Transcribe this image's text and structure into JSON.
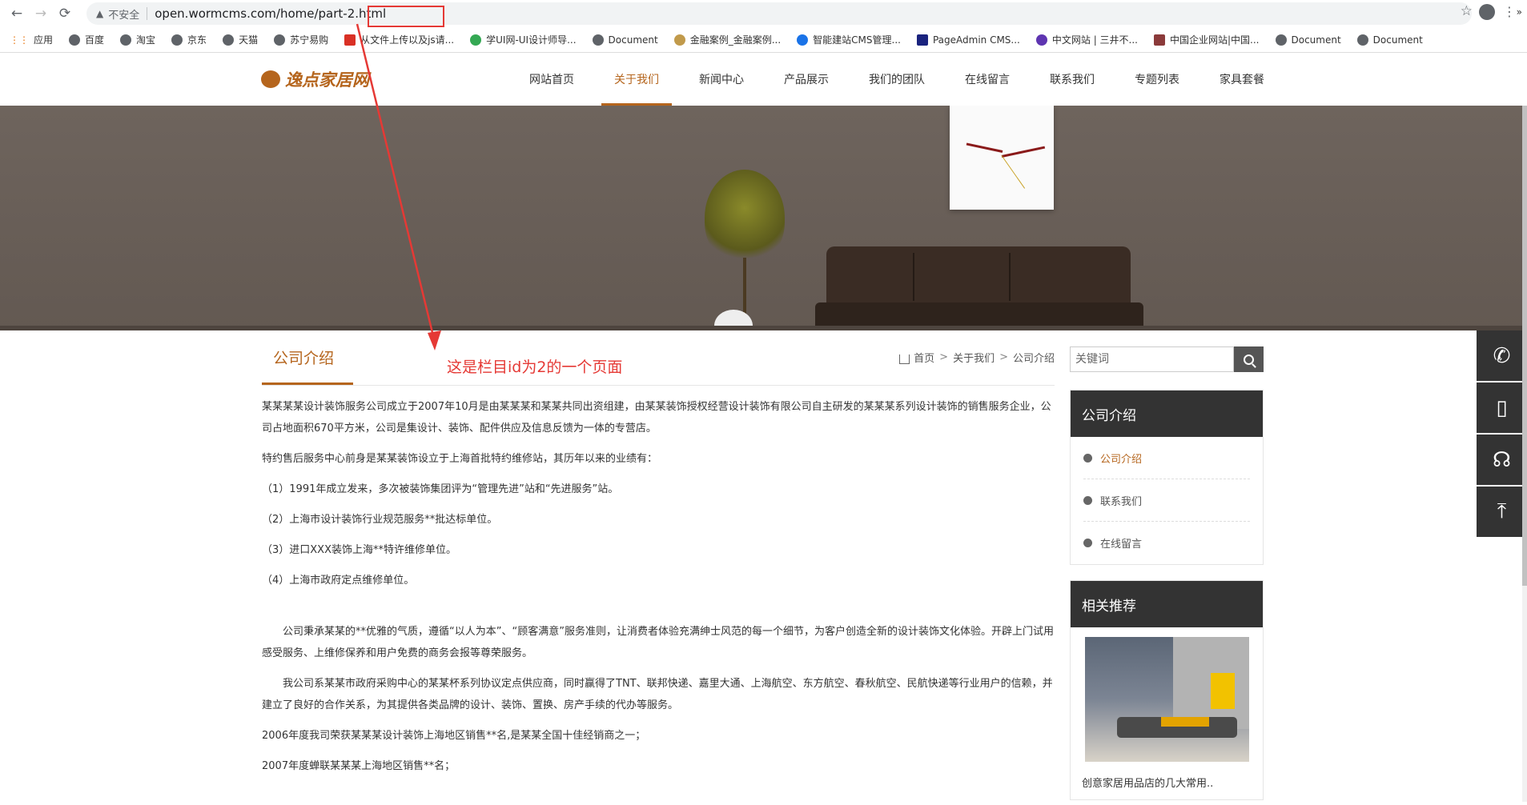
{
  "browser": {
    "security_label": "不安全",
    "url": "open.wormcms.com/home/part-2.html",
    "bookmarks": [
      {
        "label": "应用",
        "icon": "apps-grid-icon"
      },
      {
        "label": "百度",
        "icon": "globe-icon"
      },
      {
        "label": "淘宝",
        "icon": "globe-icon"
      },
      {
        "label": "京东",
        "icon": "globe-icon"
      },
      {
        "label": "天猫",
        "icon": "globe-icon"
      },
      {
        "label": "苏宁易购",
        "icon": "globe-icon"
      },
      {
        "label": "从文件上传以及js请...",
        "icon": "red-c-icon"
      },
      {
        "label": "学UI网-UI设计师导...",
        "icon": "green-icon"
      },
      {
        "label": "Document",
        "icon": "globe-icon"
      },
      {
        "label": "金融案例_金融案例...",
        "icon": "gold-icon"
      },
      {
        "label": "智能建站CMS管理...",
        "icon": "paw-icon"
      },
      {
        "label": "PageAdmin CMS...",
        "icon": "pa-icon"
      },
      {
        "label": "中文网站 | 三井不...",
        "icon": "man-icon"
      },
      {
        "label": "中国企业网站|中国...",
        "icon": "shield-icon"
      },
      {
        "label": "Document",
        "icon": "globe-icon"
      },
      {
        "label": "Document",
        "icon": "globe-icon"
      }
    ],
    "more": "»"
  },
  "site": {
    "logo_text": "逸点家居网",
    "nav": [
      {
        "label": "网站首页",
        "active": false
      },
      {
        "label": "关于我们",
        "active": true
      },
      {
        "label": "新闻中心",
        "active": false
      },
      {
        "label": "产品展示",
        "active": false
      },
      {
        "label": "我们的团队",
        "active": false
      },
      {
        "label": "在线留言",
        "active": false
      },
      {
        "label": "联系我们",
        "active": false
      },
      {
        "label": "专题列表",
        "active": false
      },
      {
        "label": "家具套餐",
        "active": false
      }
    ]
  },
  "page": {
    "title": "公司介绍",
    "breadcrumb": [
      "首页",
      "关于我们",
      "公司介绍"
    ],
    "breadcrumb_sep": ">",
    "paragraphs": [
      "某某某某设计装饰服务公司成立于2007年10月是由某某某和某某共同出资组建，由某某装饰授权经营设计装饰有限公司自主研发的某某某系列设计装饰的销售服务企业，公司占地面积670平方米，公司是集设计、装饰、配件供应及信息反馈为一体的专营店。",
      "特约售后服务中心前身是某某装饰设立于上海首批特约维修站，其历年以来的业绩有：",
      "（1）1991年成立发来，多次被装饰集团评为“管理先进”站和“先进服务”站。",
      "（2）上海市设计装饰行业规范服务**批达标单位。",
      "（3）进口XXX装饰上海**特许维修单位。",
      "（4）上海市政府定点维修单位。",
      "公司秉承某某的**优雅的气质，遵循“以人为本”、“顾客满意”服务准则，让消费者体验充满绅士风范的每一个细节，为客户创造全新的设计装饰文化体验。开辟上门试用感受服务、上维修保养和用户免费的商务会报等尊荣服务。",
      "我公司系某某市政府采购中心的某某杯系列协议定点供应商，同时赢得了TNT、联邦快递、嘉里大通、上海航空、东方航空、春秋航空、民航快递等行业用户的信赖，并建立了良好的合作关系，为其提供各类品牌的设计、装饰、置换、房产手续的代办等服务。",
      "2006年度我司荣获某某某设计装饰上海地区销售**名,是某某全国十佳经销商之一；",
      "2007年度蝉联某某某上海地区销售**名；"
    ]
  },
  "sidebar": {
    "search_placeholder": "关键词",
    "category_panel": {
      "title": "公司介绍",
      "items": [
        {
          "label": "公司介绍",
          "active": true
        },
        {
          "label": "联系我们",
          "active": false
        },
        {
          "label": "在线留言",
          "active": false
        }
      ]
    },
    "recommend_panel": {
      "title": "相关推荐",
      "item_caption": "创意家居用品店的几大常用.."
    }
  },
  "float_tools": [
    {
      "icon": "phone-icon",
      "glyph": "✆"
    },
    {
      "icon": "mobile-icon",
      "glyph": "▯"
    },
    {
      "icon": "headset-icon",
      "glyph": "☊"
    },
    {
      "icon": "back-to-top-icon",
      "glyph": "⤒"
    }
  ],
  "annotation": {
    "text": "这是栏目id为2的一个页面"
  },
  "colors": {
    "accent": "#b5651d",
    "annotation": "#e53935",
    "panel_head": "#333333"
  }
}
